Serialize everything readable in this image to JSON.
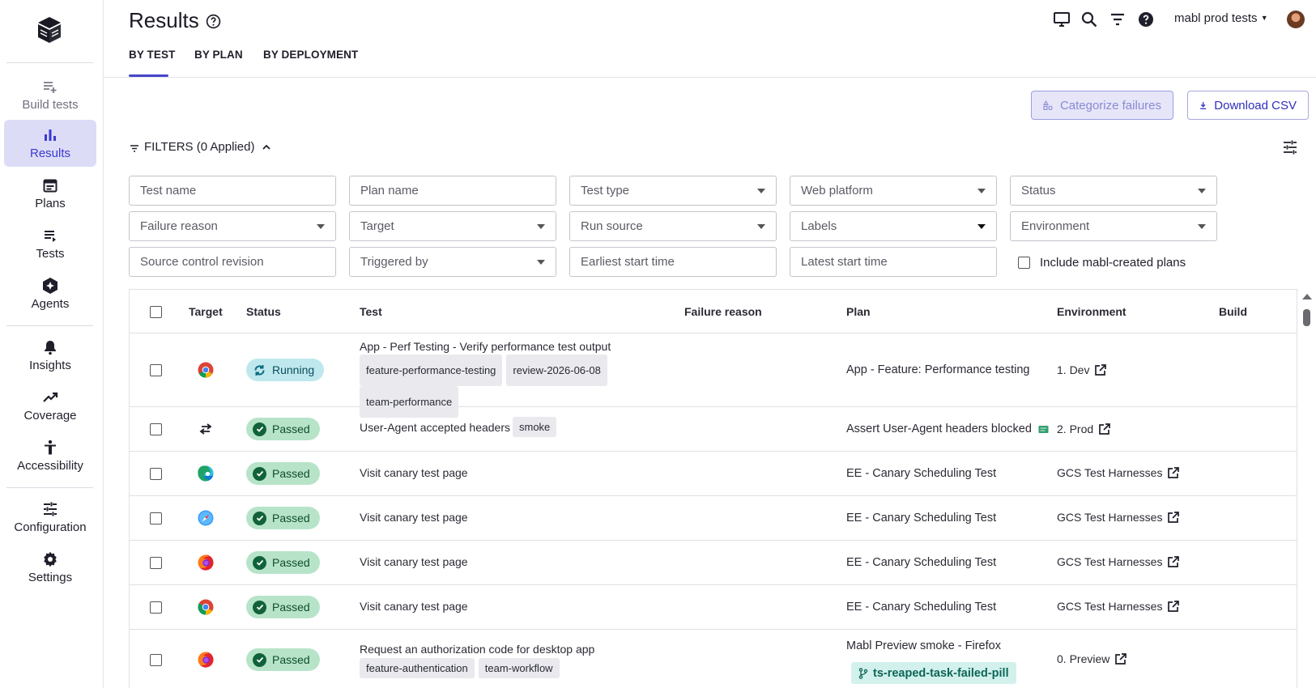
{
  "sidebar": {
    "items": [
      {
        "label": "Build tests",
        "icon": "playlist-add-icon"
      },
      {
        "label": "Results",
        "icon": "bar-chart-icon"
      },
      {
        "label": "Plans",
        "icon": "calendar-icon"
      },
      {
        "label": "Tests",
        "icon": "list-icon"
      },
      {
        "label": "Agents",
        "icon": "agent-icon"
      },
      {
        "label": "Insights",
        "icon": "bell-icon"
      },
      {
        "label": "Coverage",
        "icon": "trending-up-icon"
      },
      {
        "label": "Accessibility",
        "icon": "accessibility-icon"
      },
      {
        "label": "Configuration",
        "icon": "sliders-icon"
      },
      {
        "label": "Settings",
        "icon": "gear-icon"
      }
    ]
  },
  "header": {
    "title": "Results",
    "workspace": "mabl prod tests",
    "tabs": [
      "BY TEST",
      "BY PLAN",
      "BY DEPLOYMENT"
    ]
  },
  "actions": {
    "categorize": "Categorize failures",
    "download": "Download CSV"
  },
  "filters": {
    "toggle_label": "FILTERS (0 Applied)",
    "fields": {
      "test_name": "Test name",
      "plan_name": "Plan name",
      "test_type": "Test type",
      "web_platform": "Web platform",
      "status": "Status",
      "failure_reason": "Failure reason",
      "target": "Target",
      "run_source": "Run source",
      "labels": "Labels",
      "environment": "Environment",
      "source_control": "Source control revision",
      "triggered_by": "Triggered by",
      "earliest_start": "Earliest start time",
      "latest_start": "Latest start time"
    },
    "include_mabl": "Include mabl-created plans"
  },
  "table": {
    "columns": {
      "target": "Target",
      "status": "Status",
      "test": "Test",
      "failure_reason": "Failure reason",
      "plan": "Plan",
      "environment": "Environment",
      "build": "Build"
    },
    "rows": [
      {
        "target": "chrome-icon",
        "status": "Running",
        "test": "App - Perf Testing - Verify performance test output",
        "tags": [
          "feature-performance-testing",
          "review-2026-06-08",
          "team-performance"
        ],
        "plan": "App - Feature: Performance testing",
        "environment": "1. Dev"
      },
      {
        "target": "api-icon",
        "status": "Passed",
        "test": "User-Agent accepted headers",
        "tags": [
          "smoke"
        ],
        "plan": "Assert User-Agent headers blocked",
        "environment": "2. Prod"
      },
      {
        "target": "edge-icon",
        "status": "Passed",
        "test": "Visit canary test page",
        "tags": [],
        "plan": "EE - Canary Scheduling Test",
        "environment": "GCS Test Harnesses"
      },
      {
        "target": "safari-icon",
        "status": "Passed",
        "test": "Visit canary test page",
        "tags": [],
        "plan": "EE - Canary Scheduling Test",
        "environment": "GCS Test Harnesses"
      },
      {
        "target": "firefox-icon",
        "status": "Passed",
        "test": "Visit canary test page",
        "tags": [],
        "plan": "EE - Canary Scheduling Test",
        "environment": "GCS Test Harnesses"
      },
      {
        "target": "chrome-icon",
        "status": "Passed",
        "test": "Visit canary test page",
        "tags": [],
        "plan": "EE - Canary Scheduling Test",
        "environment": "GCS Test Harnesses"
      },
      {
        "target": "firefox-icon",
        "status": "Passed",
        "test": "Request an authorization code for desktop app",
        "tags": [
          "feature-authentication",
          "team-workflow"
        ],
        "plan": "Mabl Preview smoke - Firefox",
        "branch": "ts-reaped-task-failed-pill",
        "environment": "0. Preview"
      }
    ]
  },
  "colors": {
    "accent": "#4646c8",
    "passed_bg": "#b7e4c9",
    "running_bg": "#bfe8ee"
  }
}
